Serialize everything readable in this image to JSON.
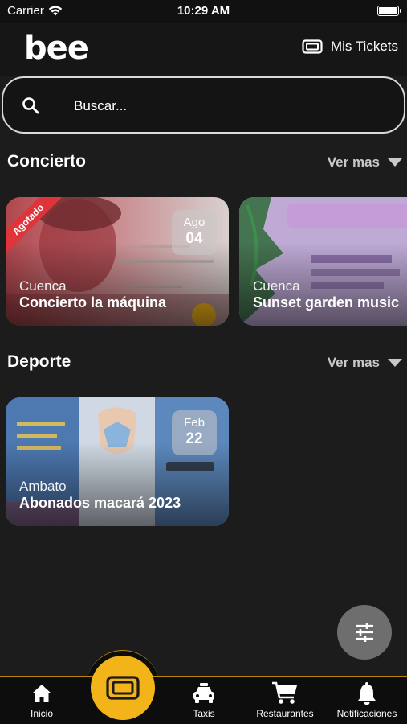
{
  "status_bar": {
    "carrier": "Carrier",
    "time": "10:29 AM"
  },
  "header": {
    "logo": "bee",
    "tickets_label": "Mis Tickets"
  },
  "search": {
    "placeholder": "Buscar..."
  },
  "sections": [
    {
      "title": "Concierto",
      "see_more": "Ver mas",
      "cards": [
        {
          "city": "Cuenca",
          "title": "Concierto la máquina",
          "month": "Ago",
          "day": "04",
          "ribbon": "Agotado"
        },
        {
          "city": "Cuenca",
          "title": "Sunset garden music"
        }
      ]
    },
    {
      "title": "Deporte",
      "see_more": "Ver mas",
      "cards": [
        {
          "city": "Ambato",
          "title": "Abonados macará 2023",
          "month": "Feb",
          "day": "22"
        }
      ]
    }
  ],
  "tab_bar": {
    "home": "Inicio",
    "taxis": "Taxis",
    "restaurants": "Restaurantes",
    "notifications": "Notificaciones"
  },
  "colors": {
    "accent": "#f2b418",
    "background": "#1c1c1c",
    "ribbon": "#e0343a"
  }
}
